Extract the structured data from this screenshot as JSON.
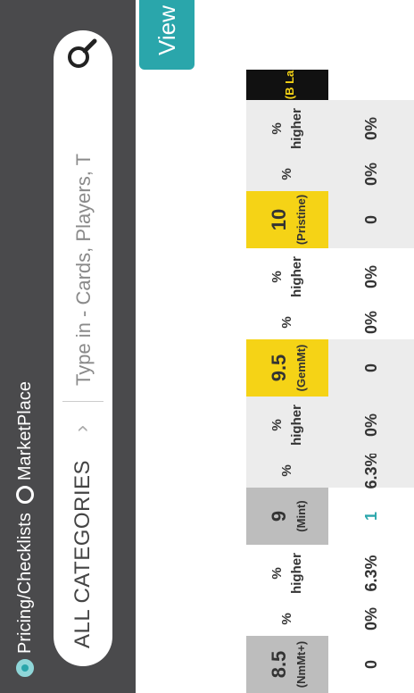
{
  "tabs": {
    "pricing_label": "Pricing/Checklists",
    "marketplace_label": "MarketPlace"
  },
  "search": {
    "category_label": "ALL CATEGORIES",
    "placeholder": "Type in - Cards, Players, T"
  },
  "view_button_label": "View",
  "table": {
    "columns": [
      {
        "type": "grade",
        "grade": "8.5",
        "label": "(NmMt+)",
        "value": "0",
        "bg": "#bdbdbd"
      },
      {
        "type": "pct",
        "line1": "%",
        "line2": "",
        "value": "0%",
        "bg": "#ffffff"
      },
      {
        "type": "pct",
        "line1": "%",
        "line2": "higher",
        "value": "6.3%",
        "bg": "#ffffff"
      },
      {
        "type": "grade",
        "grade": "9",
        "label": "(Mint)",
        "value": "1",
        "bg": "#bdbdbd"
      },
      {
        "type": "pct",
        "line1": "%",
        "line2": "",
        "value": "6.3%",
        "bg": "#ececec"
      },
      {
        "type": "pct",
        "line1": "%",
        "line2": "higher",
        "value": "0%",
        "bg": "#ececec"
      },
      {
        "type": "grade",
        "grade": "9.5",
        "label": "(GemMt)",
        "value": "0",
        "bg": "#f5d316"
      },
      {
        "type": "pct",
        "line1": "%",
        "line2": "",
        "value": "0%",
        "bg": "#ffffff"
      },
      {
        "type": "pct",
        "line1": "%",
        "line2": "higher",
        "value": "0%",
        "bg": "#ffffff"
      },
      {
        "type": "grade",
        "grade": "10",
        "label": "(Pristine)",
        "value": "0",
        "bg": "#f5d316"
      },
      {
        "type": "pct",
        "line1": "%",
        "line2": "",
        "value": "0%",
        "bg": "#ececec"
      },
      {
        "type": "pct",
        "line1": "%",
        "line2": "higher",
        "value": "0%",
        "bg": "#ececec"
      },
      {
        "type": "grade",
        "grade": "",
        "label": "(B La",
        "value": "",
        "bg": "#111111"
      }
    ]
  },
  "colors": {
    "header_bg": "#4a4a4c",
    "accent": "#2aa6ab",
    "gold": "#f5d316"
  }
}
